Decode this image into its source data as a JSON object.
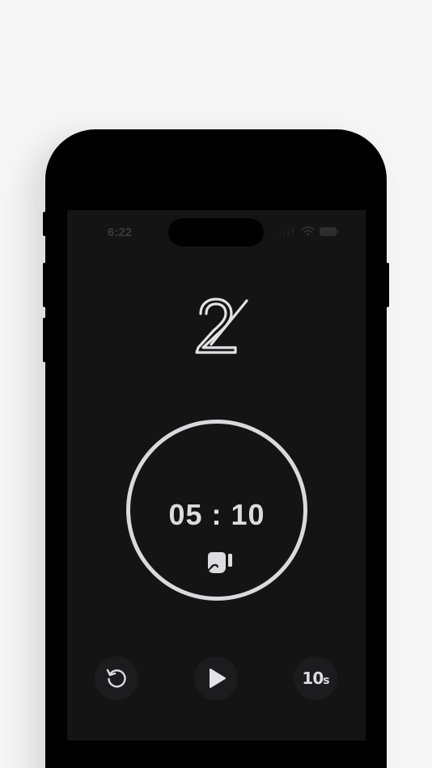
{
  "status_bar": {
    "time": "6:22",
    "icons": [
      "signal-icon",
      "wifi-icon",
      "battery-icon"
    ]
  },
  "logo": {
    "icon": "logo-2-icon"
  },
  "timer": {
    "display": "05 : 10",
    "mode_icon": "boxing-glove-icon"
  },
  "controls": {
    "reset_icon": "reset-icon",
    "play_icon": "play-icon",
    "skip_label_number": "10",
    "skip_label_unit": "s"
  },
  "colors": {
    "screen_bg": "#141414",
    "foreground": "#dcdce0",
    "button_bg": "#1c1c1e",
    "page_bg": "#f6f6f6"
  }
}
